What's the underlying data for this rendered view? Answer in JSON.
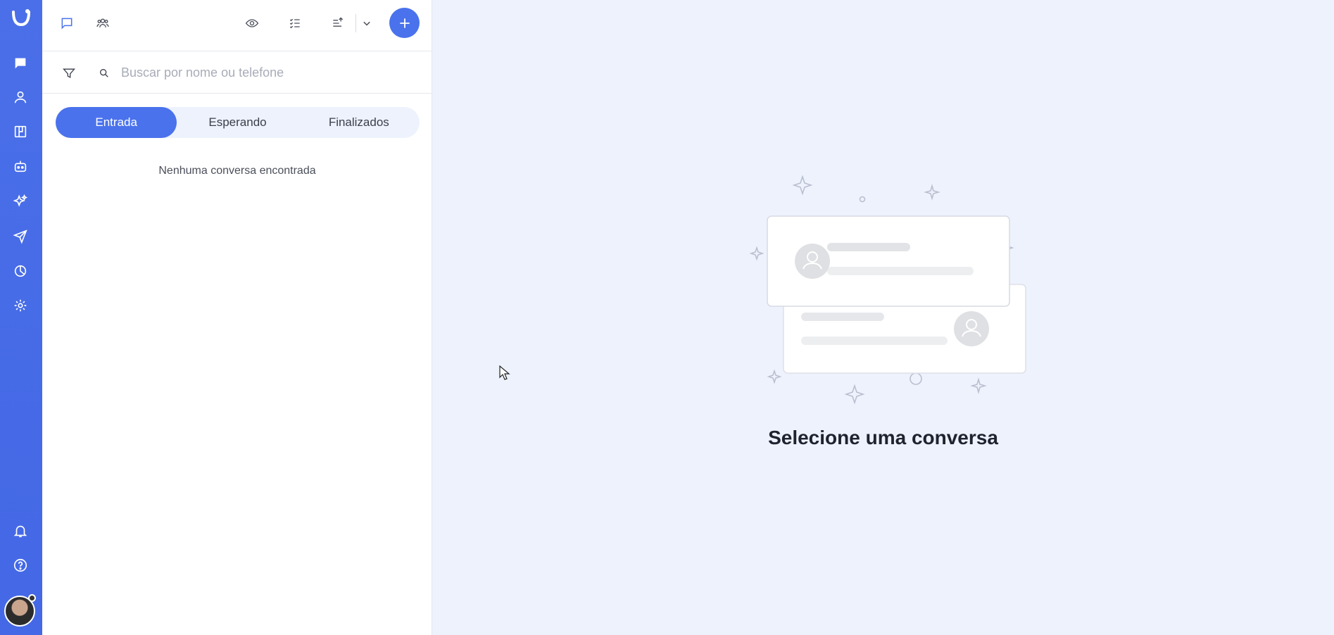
{
  "rail": {
    "logo": "brand-logo",
    "items": [
      {
        "name": "chat-icon"
      },
      {
        "name": "contacts-icon"
      },
      {
        "name": "kanban-icon"
      },
      {
        "name": "bot-icon"
      },
      {
        "name": "sparkles-icon"
      },
      {
        "name": "send-icon"
      },
      {
        "name": "reports-icon"
      },
      {
        "name": "settings-icon"
      }
    ],
    "bottom": [
      {
        "name": "bell-icon"
      },
      {
        "name": "help-icon"
      }
    ],
    "accent": "#4a6fe8"
  },
  "conversations": {
    "search": {
      "placeholder": "Buscar por nome ou telefone",
      "value": ""
    },
    "tabs": [
      "Entrada",
      "Esperando",
      "Finalizados"
    ],
    "active_tab": "Entrada",
    "empty_message": "Nenhuma conversa encontrada"
  },
  "main": {
    "title": "Selecione uma conversa"
  }
}
